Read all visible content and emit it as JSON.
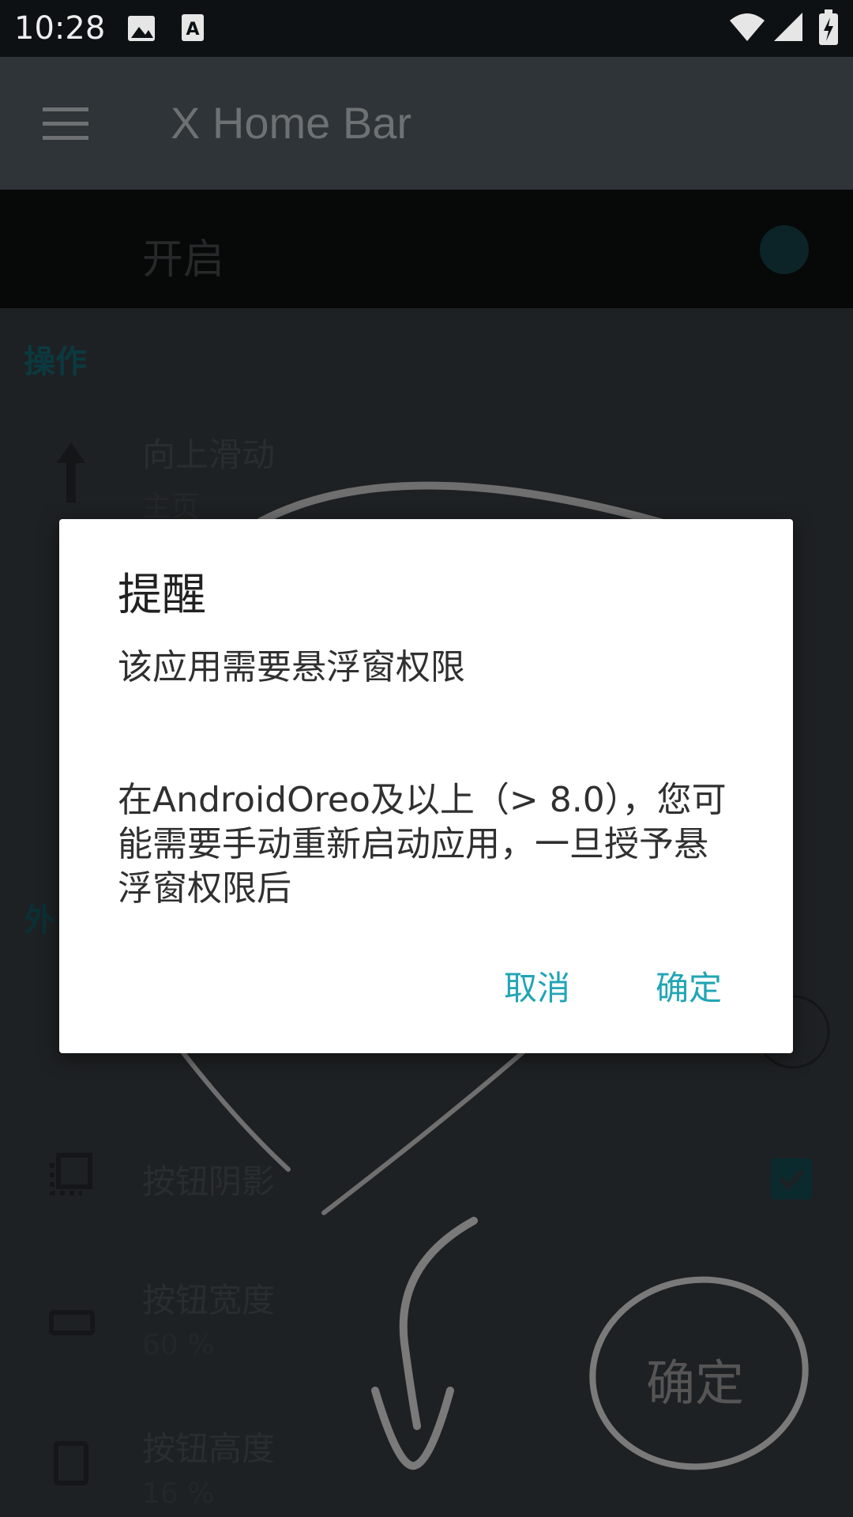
{
  "status_bar": {
    "time": "10:28"
  },
  "app_bar": {
    "title": "X Home Bar"
  },
  "settings": {
    "enable_label": "开启",
    "section_operations": "操作",
    "swipe_up_title": "向上滑动",
    "swipe_up_value": "主页",
    "section_appearance": "外",
    "button_shadow_title": "按钮阴影",
    "button_shadow_checked": true,
    "button_width_title": "按钮宽度",
    "button_width_value": "60 %",
    "button_height_title": "按钮高度",
    "button_height_value": "16 %"
  },
  "dialog": {
    "title": "提醒",
    "message": "该应用需要悬浮窗权限\n\n\n在AndroidOreo及以上（> 8.0），您可能需要手动重新启动应用，一旦授予悬浮窗权限后",
    "cancel_label": "取消",
    "ok_label": "确定"
  },
  "hint_overlay": {
    "label": "确定"
  },
  "colors": {
    "accent": "#21a5b5",
    "dialog_bg": "#ffffff",
    "status_bar": "#0d1113",
    "app_bar": "#2f3438"
  },
  "icons": [
    "image-icon",
    "a-letter-icon",
    "wifi-icon",
    "signal-icon",
    "battery-icon",
    "menu-icon",
    "arrow-up-icon",
    "shadow-icon",
    "width-icon",
    "height-icon",
    "checkbox-icon"
  ]
}
